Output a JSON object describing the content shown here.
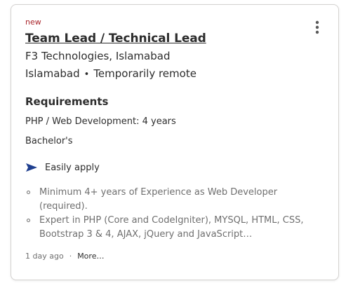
{
  "card": {
    "badge": "new",
    "title": "Team Lead / Technical Lead",
    "company": "F3 Technologies, Islamabad",
    "location": "Islamabad",
    "location_separator": "•",
    "work_mode": "Temporarily remote",
    "more_options_icon": "vertical-ellipsis-icon"
  },
  "requirements": {
    "heading": "Requirements",
    "items": [
      "PHP / Web Development: 4 years",
      "Bachelor's"
    ]
  },
  "easy_apply": {
    "icon": "paper-plane-icon",
    "label": "Easily apply",
    "icon_color": "#1f3f8f"
  },
  "snippet": [
    "Minimum 4+ years of Experience as Web Developer (required).",
    "Expert in PHP (Core and CodeIgniter), MYSQL, HTML, CSS, Bootstrap 3 & 4, AJAX, jQuery and JavaScript…"
  ],
  "footer": {
    "posted": "1 day ago",
    "separator": "·",
    "more_link": "More…"
  },
  "colors": {
    "badge": "#a9252b",
    "text": "#2d2d2d",
    "muted": "#6f6f6f",
    "border": "#d4d2d0"
  }
}
